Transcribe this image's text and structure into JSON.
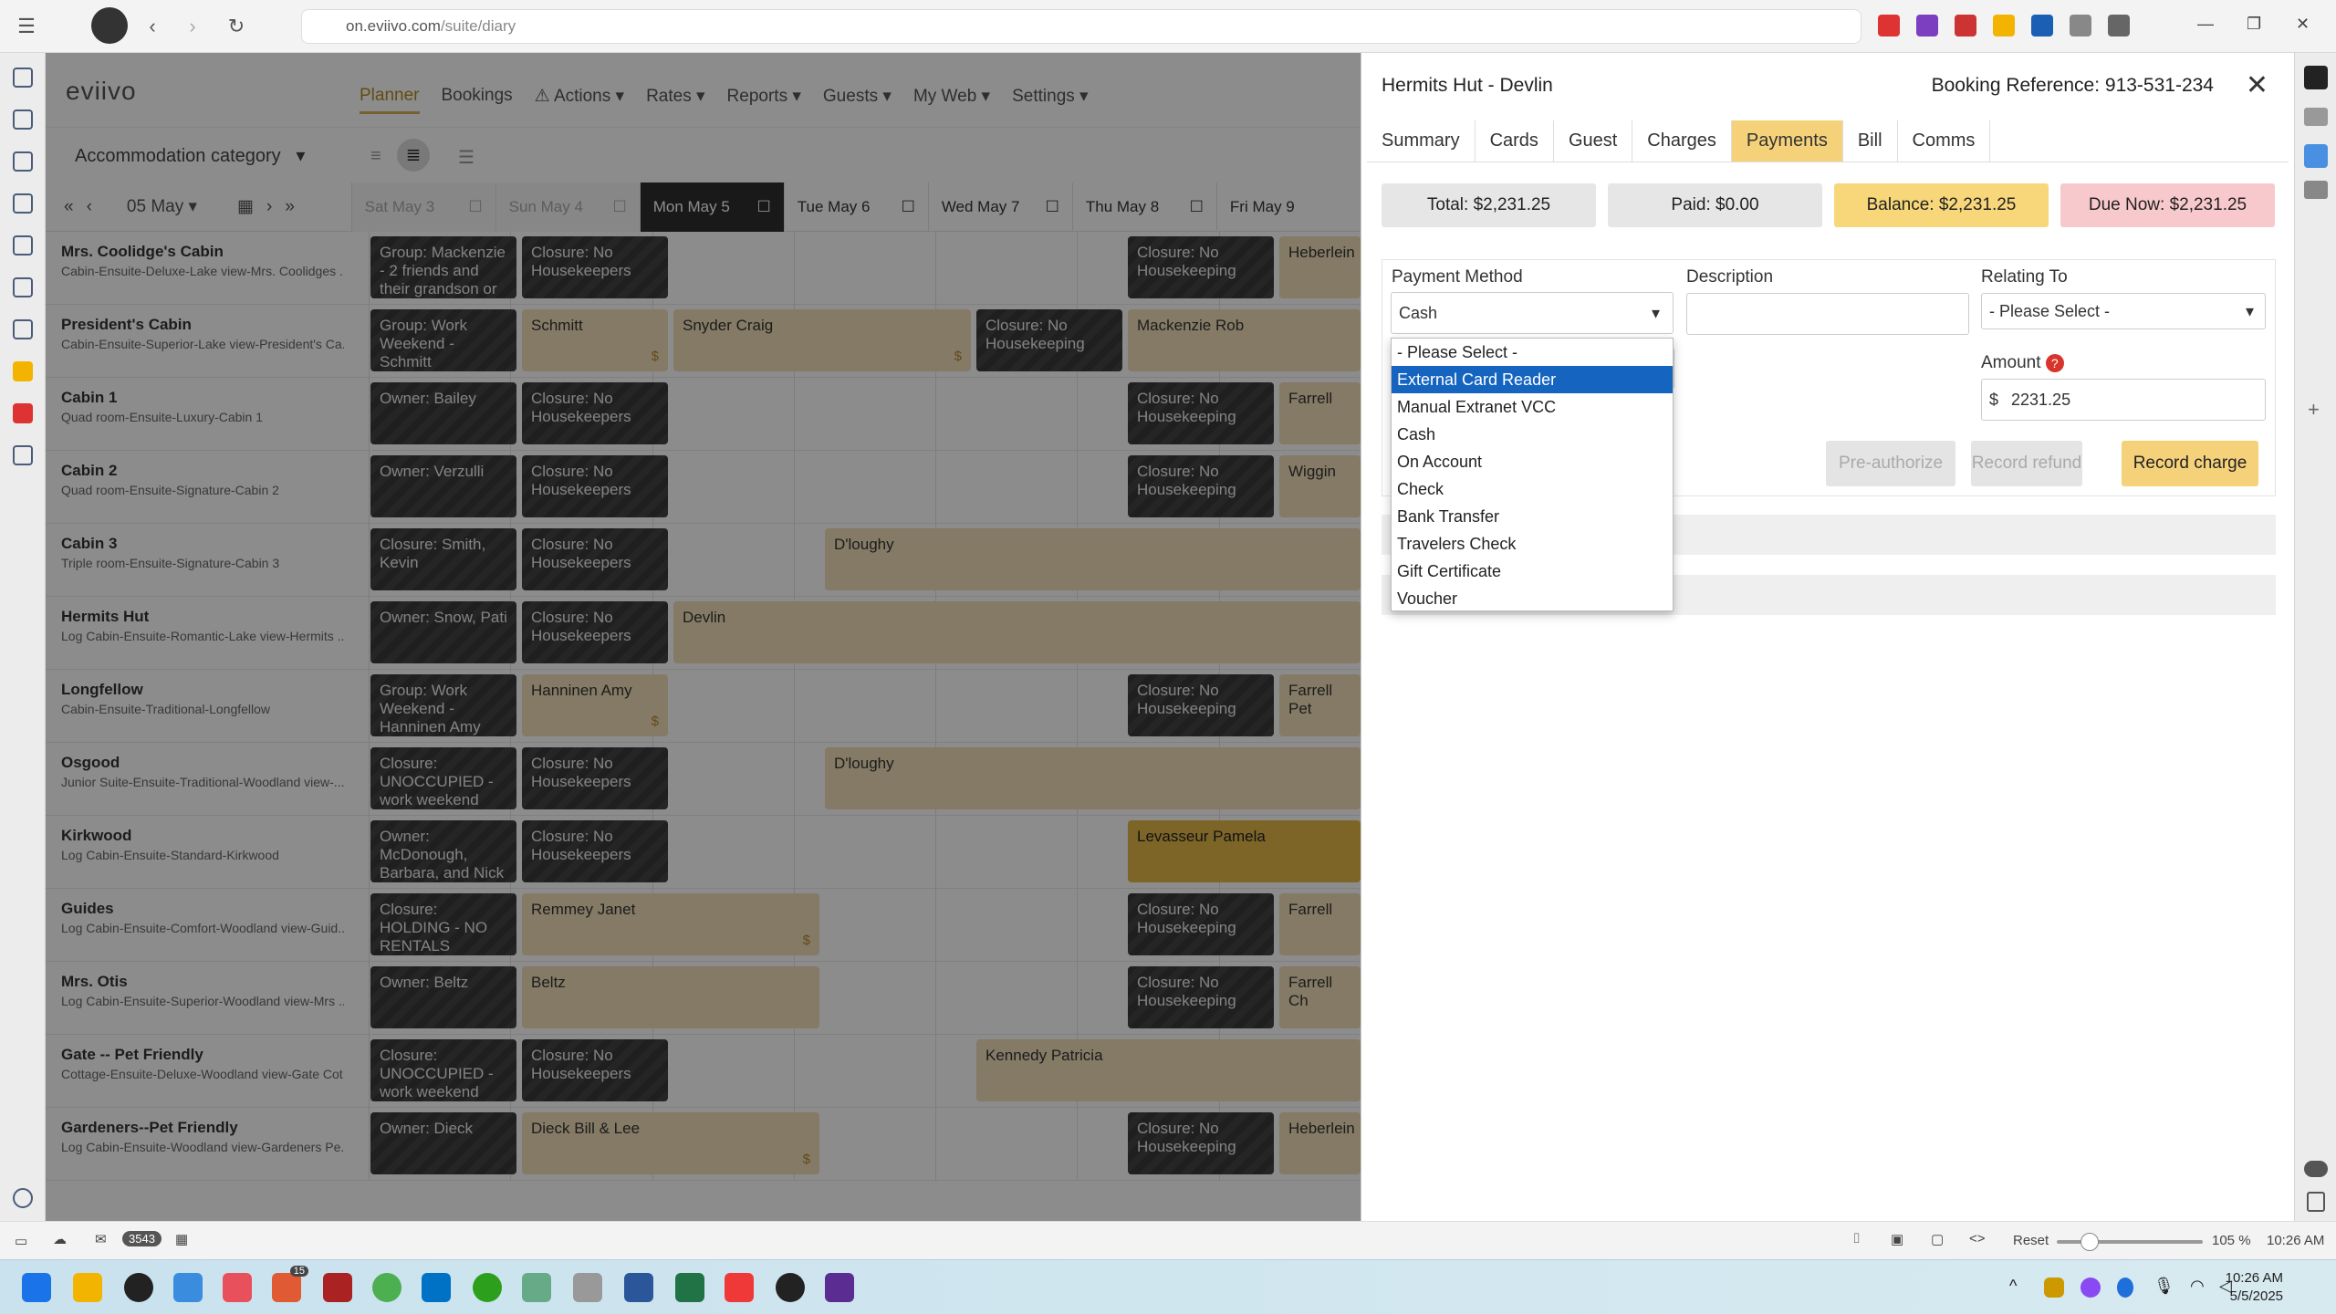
{
  "browser": {
    "url_prefix": "on.eviivo.com",
    "url_path": "/suite/diary"
  },
  "app": {
    "logo": "eviivo",
    "nav": [
      "Planner",
      "Bookings",
      "Actions",
      "Rates",
      "Reports",
      "Guests",
      "My Web",
      "Settings"
    ],
    "accommodation_category": "Accommodation category",
    "date_label": "05 May",
    "days": [
      {
        "label": "Sat May 3"
      },
      {
        "label": "Sun May 4"
      },
      {
        "label": "Mon May 5"
      },
      {
        "label": "Tue May 6"
      },
      {
        "label": "Wed May 7"
      },
      {
        "label": "Thu May 8"
      },
      {
        "label": "Fri May 9"
      }
    ],
    "rooms": [
      {
        "name": "Mrs. Coolidge's Cabin",
        "desc": "Cabin-Ensuite-Deluxe-Lake view-Mrs. Coolidges ..."
      },
      {
        "name": "President's Cabin",
        "desc": "Cabin-Ensuite-Superior-Lake view-President's Ca..."
      },
      {
        "name": "Cabin 1",
        "desc": "Quad room-Ensuite-Luxury-Cabin 1"
      },
      {
        "name": "Cabin 2",
        "desc": "Quad room-Ensuite-Signature-Cabin 2"
      },
      {
        "name": "Cabin 3",
        "desc": "Triple room-Ensuite-Signature-Cabin 3"
      },
      {
        "name": "Hermits Hut",
        "desc": "Log Cabin-Ensuite-Romantic-Lake view-Hermits ..."
      },
      {
        "name": "Longfellow",
        "desc": "Cabin-Ensuite-Traditional-Longfellow"
      },
      {
        "name": "Osgood",
        "desc": "Junior Suite-Ensuite-Traditional-Woodland view-..."
      },
      {
        "name": "Kirkwood",
        "desc": "Log Cabin-Ensuite-Standard-Kirkwood"
      },
      {
        "name": "Guides",
        "desc": "Log Cabin-Ensuite-Comfort-Woodland view-Guid..."
      },
      {
        "name": "Mrs. Otis",
        "desc": "Log Cabin-Ensuite-Superior-Woodland view-Mrs ..."
      },
      {
        "name": "Gate -- Pet Friendly",
        "desc": "Cottage-Ensuite-Deluxe-Woodland view-Gate Cot..."
      },
      {
        "name": "Gardeners--Pet Friendly",
        "desc": "Log Cabin-Ensuite-Woodland view-Gardeners Pe..."
      }
    ],
    "blocks": [
      {
        "row": 0,
        "text": "Group: Mackenzie - 2 friends and their grandson or",
        "style": "dark",
        "start": 0,
        "span": 1
      },
      {
        "row": 0,
        "text": "Closure: No Housekeepers",
        "style": "dark",
        "start": 1,
        "span": 1
      },
      {
        "row": 0,
        "text": "Closure: No Housekeeping",
        "style": "dark",
        "start": 5,
        "span": 1
      },
      {
        "row": 0,
        "text": "Heberlein",
        "style": "tan",
        "start": 6,
        "span": 1
      },
      {
        "row": 1,
        "text": "Group: Work Weekend - Schmitt",
        "style": "dark",
        "start": 0,
        "span": 1
      },
      {
        "row": 1,
        "text": "Schmitt",
        "style": "tan",
        "start": 1,
        "span": 1,
        "dollar": "$"
      },
      {
        "row": 1,
        "text": "Snyder Craig",
        "style": "tan",
        "start": 2,
        "span": 2,
        "dollar": "$"
      },
      {
        "row": 1,
        "text": "Closure: No Housekeeping",
        "style": "dark",
        "start": 4,
        "span": 1
      },
      {
        "row": 1,
        "text": "Mackenzie Rob",
        "style": "tan",
        "start": 5,
        "span": 2
      },
      {
        "row": 2,
        "text": "Owner: Bailey",
        "style": "dark",
        "start": 0,
        "span": 1
      },
      {
        "row": 2,
        "text": "Closure: No Housekeepers",
        "style": "dark",
        "start": 1,
        "span": 1
      },
      {
        "row": 2,
        "text": "Closure: No Housekeeping",
        "style": "dark",
        "start": 5,
        "span": 1
      },
      {
        "row": 2,
        "text": "Farrell",
        "style": "tan",
        "start": 6,
        "span": 1
      },
      {
        "row": 3,
        "text": "Owner: Verzulli",
        "style": "dark",
        "start": 0,
        "span": 1
      },
      {
        "row": 3,
        "text": "Closure: No Housekeepers",
        "style": "dark",
        "start": 1,
        "span": 1
      },
      {
        "row": 3,
        "text": "Closure: No Housekeeping",
        "style": "dark",
        "start": 5,
        "span": 1
      },
      {
        "row": 3,
        "text": "Wiggin",
        "style": "tan",
        "start": 6,
        "span": 1
      },
      {
        "row": 4,
        "text": "Closure: Smith, Kevin",
        "style": "dark",
        "start": 0,
        "span": 1
      },
      {
        "row": 4,
        "text": "Closure: No Housekeepers",
        "style": "dark",
        "start": 1,
        "span": 1
      },
      {
        "row": 4,
        "text": "D'loughy",
        "style": "tan",
        "start": 3,
        "span": 4
      },
      {
        "row": 5,
        "text": "Owner: Snow, Pati",
        "style": "dark",
        "start": 0,
        "span": 1
      },
      {
        "row": 5,
        "text": "Closure: No Housekeepers",
        "style": "dark",
        "start": 1,
        "span": 1
      },
      {
        "row": 5,
        "text": "Devlin",
        "style": "tan",
        "start": 2,
        "span": 5
      },
      {
        "row": 6,
        "text": "Group: Work Weekend - Hanninen Amy",
        "style": "dark",
        "start": 0,
        "span": 1
      },
      {
        "row": 6,
        "text": "Hanninen Amy",
        "style": "tan",
        "start": 1,
        "span": 1,
        "dollar": "$"
      },
      {
        "row": 6,
        "text": "Closure: No Housekeeping",
        "style": "dark",
        "start": 5,
        "span": 1
      },
      {
        "row": 6,
        "text": "Farrell Pet",
        "style": "tan",
        "start": 6,
        "span": 1
      },
      {
        "row": 7,
        "text": "Closure: UNOCCUPIED - work weekend",
        "style": "dark",
        "start": 0,
        "span": 1
      },
      {
        "row": 7,
        "text": "Closure: No Housekeepers",
        "style": "dark",
        "start": 1,
        "span": 1
      },
      {
        "row": 7,
        "text": "D'loughy",
        "style": "tan",
        "start": 3,
        "span": 4
      },
      {
        "row": 8,
        "text": "Owner: McDonough, Barbara, and Nick",
        "style": "dark",
        "start": 0,
        "span": 1
      },
      {
        "row": 8,
        "text": "Closure: No Housekeepers",
        "style": "dark",
        "start": 1,
        "span": 1
      },
      {
        "row": 8,
        "text": "Levasseur Pamela",
        "style": "gold",
        "start": 5,
        "span": 2
      },
      {
        "row": 9,
        "text": "Closure: HOLDING - NO RENTALS",
        "style": "dark",
        "start": 0,
        "span": 1
      },
      {
        "row": 9,
        "text": "Remmey Janet",
        "style": "tan",
        "start": 1,
        "span": 2,
        "dollar": "$"
      },
      {
        "row": 9,
        "text": "Closure: No Housekeeping",
        "style": "dark",
        "start": 5,
        "span": 1
      },
      {
        "row": 9,
        "text": "Farrell",
        "style": "tan",
        "start": 6,
        "span": 1
      },
      {
        "row": 10,
        "text": "Owner: Beltz",
        "style": "dark",
        "start": 0,
        "span": 1
      },
      {
        "row": 10,
        "text": "Beltz",
        "style": "tan",
        "start": 1,
        "span": 2
      },
      {
        "row": 10,
        "text": "Closure: No Housekeeping",
        "style": "dark",
        "start": 5,
        "span": 1
      },
      {
        "row": 10,
        "text": "Farrell Ch",
        "style": "tan",
        "start": 6,
        "span": 1
      },
      {
        "row": 11,
        "text": "Closure: UNOCCUPIED - work weekend",
        "style": "dark",
        "start": 0,
        "span": 1
      },
      {
        "row": 11,
        "text": "Closure: No Housekeepers",
        "style": "dark",
        "start": 1,
        "span": 1
      },
      {
        "row": 11,
        "text": "Kennedy Patricia",
        "style": "tan",
        "start": 4,
        "span": 3
      },
      {
        "row": 12,
        "text": "Owner: Dieck",
        "style": "dark",
        "start": 0,
        "span": 1
      },
      {
        "row": 12,
        "text": "Dieck Bill & Lee",
        "style": "tan",
        "start": 1,
        "span": 2,
        "dollar": "$"
      },
      {
        "row": 12,
        "text": "Closure: No Housekeeping",
        "style": "dark",
        "start": 5,
        "span": 1
      },
      {
        "row": 12,
        "text": "Heberlein",
        "style": "tan",
        "start": 6,
        "span": 1
      }
    ]
  },
  "panel": {
    "title": "Hermits Hut - Devlin",
    "booking_ref": "Booking Reference: 913-531-234",
    "tabs": [
      "Summary",
      "Cards",
      "Guest",
      "Charges",
      "Payments",
      "Bill",
      "Comms"
    ],
    "active_tab": "Payments",
    "totals": {
      "total": "Total: $2,231.25",
      "paid": "Paid: $0.00",
      "balance": "Balance: $2,231.25",
      "due": "Due Now: $2,231.25"
    },
    "form": {
      "payment_method_label": "Payment Method",
      "payment_method_value": "Cash",
      "description_label": "Description",
      "relating_label": "Relating To",
      "relating_value": "- Please Select -",
      "amount_label": "Amount",
      "currency": "$",
      "amount_value": "2231.25",
      "preauth": "Pre-authorize",
      "refund": "Record refund",
      "charge": "Record charge"
    },
    "dropdown_options": [
      "- Please Select -",
      "External Card Reader",
      "Manual Extranet VCC",
      "Cash",
      "On Account",
      "Check",
      "Bank Transfer",
      "Travelers Check",
      "Gift Certificate",
      "Voucher"
    ],
    "dropdown_highlighted": "External Card Reader"
  },
  "status_bar": {
    "mail_count": "3543",
    "reset": "Reset",
    "zoom": "105 %",
    "time": "10:26 AM"
  },
  "taskbar": {
    "time": "10:26 AM",
    "date": "5/5/2025",
    "badge": "15"
  },
  "colors": {
    "accent": "#f5d27a",
    "selected": "#1565c0",
    "balance_bg": "#f7d77a",
    "due_bg": "#f8c9cc",
    "booking_tan": "#f0dfb9",
    "closure_dark": "#3a3a3a"
  }
}
